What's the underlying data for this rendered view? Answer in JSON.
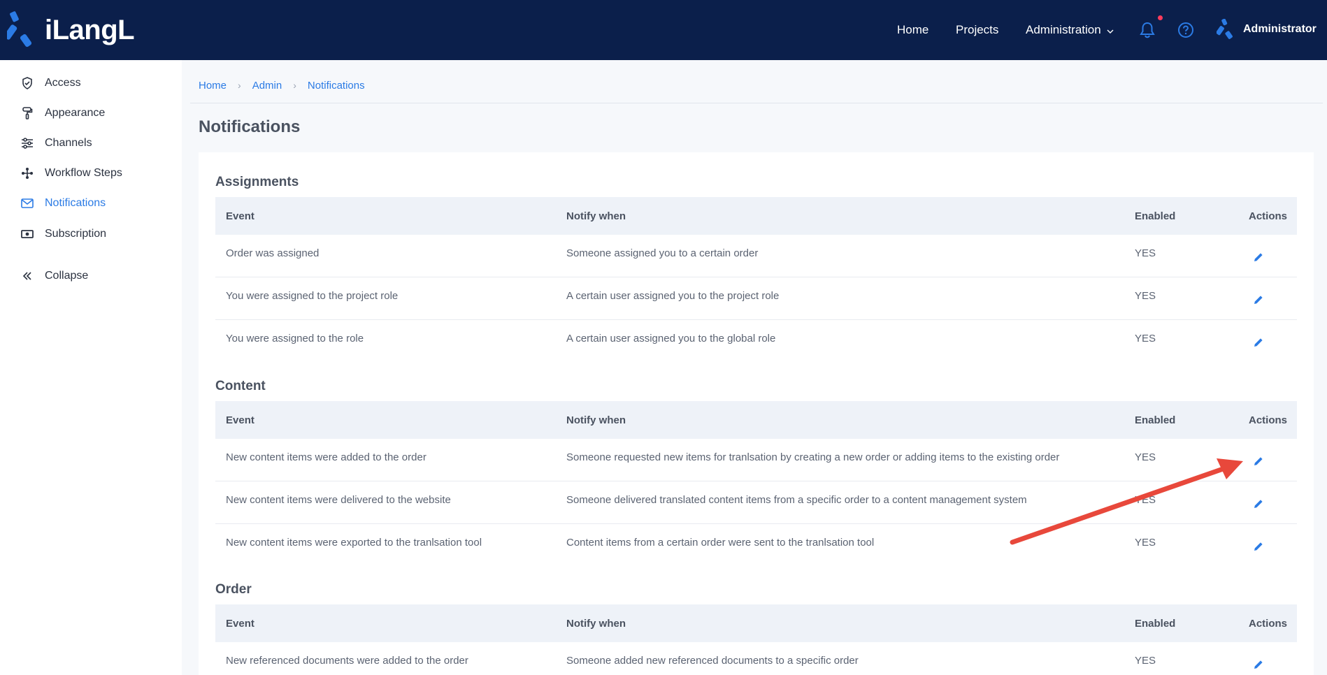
{
  "app": {
    "logo_text": "iLangL"
  },
  "topnav": {
    "home": "Home",
    "projects": "Projects",
    "administration": "Administration",
    "user": "Administrator"
  },
  "sidebar": {
    "items": [
      {
        "label": "Access",
        "icon": "shield-icon"
      },
      {
        "label": "Appearance",
        "icon": "paint-roller-icon"
      },
      {
        "label": "Channels",
        "icon": "sliders-icon"
      },
      {
        "label": "Workflow Steps",
        "icon": "workflow-icon"
      },
      {
        "label": "Notifications",
        "icon": "mail-icon",
        "active": true
      },
      {
        "label": "Subscription",
        "icon": "money-icon"
      },
      {
        "label": "Collapse",
        "icon": "double-chevron-left-icon"
      }
    ]
  },
  "breadcrumb": [
    "Home",
    "Admin",
    "Notifications"
  ],
  "page": {
    "title": "Notifications"
  },
  "table_headers": {
    "event": "Event",
    "notify": "Notify when",
    "enabled": "Enabled",
    "actions": "Actions"
  },
  "sections": [
    {
      "title": "Assignments",
      "rows": [
        {
          "event": "Order was assigned",
          "notify": "Someone assigned you to a certain order",
          "enabled": "YES"
        },
        {
          "event": "You were assigned to the project role",
          "notify": "A certain user assigned you to the project role",
          "enabled": "YES"
        },
        {
          "event": "You were assigned to the role",
          "notify": "A certain user assigned you to the global role",
          "enabled": "YES"
        }
      ]
    },
    {
      "title": "Content",
      "rows": [
        {
          "event": "New content items were added to the order",
          "notify": "Someone requested new items for tranlsation by creating a new order or adding items to the existing order",
          "enabled": "YES"
        },
        {
          "event": "New content items were delivered to the website",
          "notify": "Someone delivered translated content items from a specific order to a content management system",
          "enabled": "YES"
        },
        {
          "event": "New content items were exported to the tranlsation tool",
          "notify": "Content items from a certain order were sent to the tranlsation tool",
          "enabled": "YES"
        }
      ]
    },
    {
      "title": "Order",
      "rows": [
        {
          "event": "New referenced documents were added to the order",
          "notify": "Someone added new referenced documents to a specific order",
          "enabled": "YES"
        }
      ]
    }
  ],
  "colors": {
    "topbar": "#0b1f4b",
    "accent": "#2b7be5",
    "arrow": "#e8483b",
    "notification_dot": "#ff3b5c"
  }
}
